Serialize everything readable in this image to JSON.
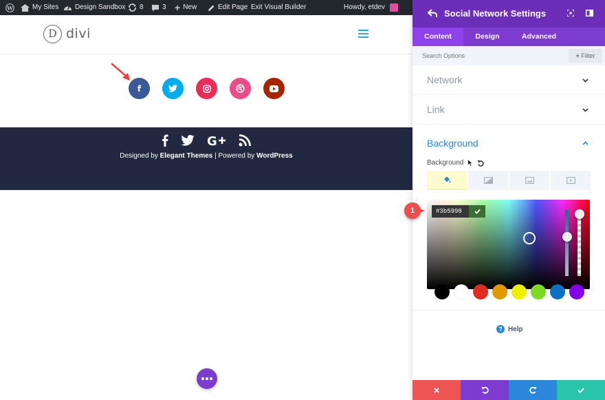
{
  "adminbar": {
    "my_sites": "My Sites",
    "design_sandbox": "Design Sandbox",
    "updates_count": "8",
    "comments_count": "3",
    "new_label": "New",
    "edit_page": "Edit Page",
    "exit_builder": "Exit Visual Builder",
    "howdy": "Howdy, etdev"
  },
  "site": {
    "logo_letter": "D",
    "logo_text": "divi"
  },
  "social_icons": [
    {
      "network": "facebook",
      "glyph": "f",
      "color": "#3b5998"
    },
    {
      "network": "twitter",
      "color": "#00aced"
    },
    {
      "network": "instagram",
      "color": "#ea2c59"
    },
    {
      "network": "dribbble",
      "color": "#ea4c89"
    },
    {
      "network": "youtube",
      "color": "#a82400"
    }
  ],
  "footer": {
    "designed_by": "Designed by",
    "elegant_themes": "Elegant Themes",
    "separator": "| Powered by",
    "wordpress": "WordPress"
  },
  "panel": {
    "title": "Social Network Settings",
    "tabs": [
      {
        "label": "Content",
        "active": true
      },
      {
        "label": "Design",
        "active": false
      },
      {
        "label": "Advanced",
        "active": false
      }
    ],
    "search_placeholder": "Search Options",
    "filter_label": "Filter",
    "sections": {
      "network": "Network",
      "link": "Link",
      "background": "Background"
    },
    "background_label": "Background",
    "hex_value": "#3b5998",
    "marker_number": "1",
    "swatches": [
      "#000000",
      "#ffffff",
      "#e02b20",
      "#e09900",
      "#edf000",
      "#7cda24",
      "#0c71c3",
      "#8300e9"
    ],
    "help_label": "Help"
  },
  "colors": {
    "panel_header": "#6c2eb9",
    "panel_tabs": "#7e3bd0",
    "footer_bg": "#222840",
    "accent_blue": "#2ea3f2",
    "cancel": "#ef5555",
    "undo": "#7e3bd0",
    "redo": "#2b87da",
    "save": "#29c4a9"
  }
}
